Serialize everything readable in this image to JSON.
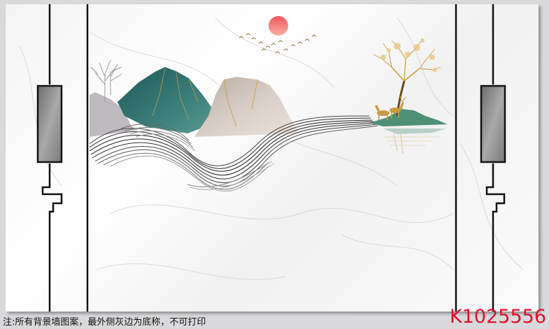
{
  "caption": "注:所有背景墙图案，最外侧灰边为底称，不可打印",
  "product_code": "K1025556",
  "colors": {
    "sun": "#e9464a",
    "mountain_teal": "#2f6d6c",
    "mountain_beige": "#cfc2b8",
    "gold": "#c99a3e",
    "code_red": "#e0102a"
  },
  "icons": [
    "sun-icon",
    "birds-icon",
    "deer-icon",
    "tree-icon"
  ]
}
